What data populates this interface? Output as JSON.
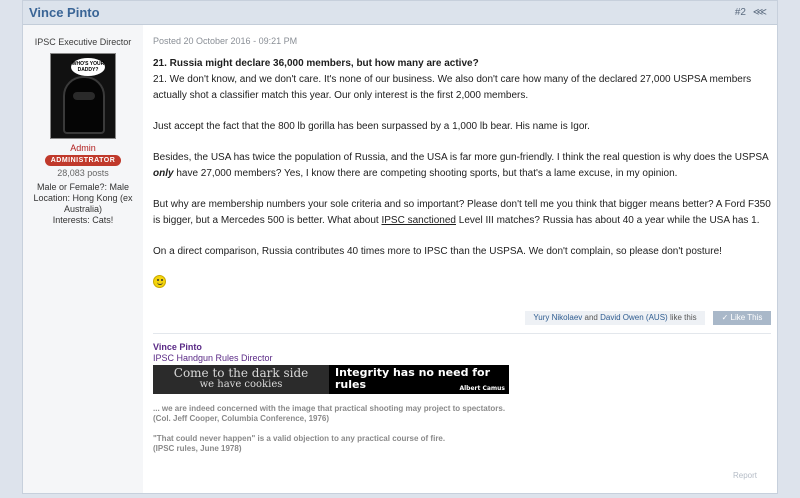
{
  "post": {
    "author": "Vince Pinto",
    "number": "#2",
    "share_icon": "share-icon"
  },
  "author_info": {
    "title": "IPSC Executive Director",
    "avatar_text": "WHO'S YOUR DADDY?",
    "role": "Admin",
    "badge": "ADMINISTRATOR",
    "posts": "28,083 posts",
    "gender_label": "Male or Female?:",
    "gender_value": "Male",
    "location_label": "Location:",
    "location_value": "Hong Kong (ex Australia)",
    "interests_label": "Interests:",
    "interests_value": "Cats!"
  },
  "content": {
    "posted": "Posted 20 October 2016 - 09:21 PM",
    "question": "21. Russia might declare 36,000 members, but how many are active?",
    "p1": "21. We don't know, and we don't care. It's none of our business. We also don't care how many of the declared 27,000 USPSA members actually shot a classifier match this year. Our only interest is the first 2,000 members.",
    "p2": "Just accept the fact that the 800 lb gorilla has been surpassed by a 1,000 lb bear. His name is Igor.",
    "p3_a": "Besides, the USA has twice the population of Russia, and the USA is far more gun-friendly. I think the real question is why does the USPSA",
    "p3_em": "only",
    "p3_b": "have 27,000 members? Yes, I know there are competing shooting sports, but that's a lame excuse, in my opinion.",
    "p4_a": "But why are membership numbers your sole criteria and so important? Please don't tell me you think that bigger means better? A Ford F350 is bigger, but a Mercedes 500 is better. What about",
    "p4_link": "IPSC sanctioned",
    "p4_b": "Level III matches? Russia has about 40 a year while the USA has 1.",
    "p5": "On a direct comparison, Russia contributes 40 times more to IPSC than the USPSA. We don't complain, so please don't posture!"
  },
  "likes": {
    "user1": "Yury Nikolaev",
    "and": "and",
    "user2": "David Owen (AUS)",
    "suffix": "like this",
    "button": "Like This",
    "button_icon": "check-icon"
  },
  "signature": {
    "name": "Vince Pinto",
    "title": "IPSC Handgun Rules Director",
    "banner1_line1": "Come to the dark side",
    "banner1_line2": "we have cookies",
    "banner2_text": "Integrity has no need for rules",
    "banner2_author": "Albert Camus",
    "quote1": "... we are indeed concerned with the image that practical shooting may project to spectators.",
    "quote1_src": "(Col. Jeff Cooper, Columbia Conference, 1976)",
    "quote2": "\"That could never happen\" is a valid objection to any practical course of fire.",
    "quote2_src": "(IPSC rules, June 1978)"
  },
  "report": "Report"
}
